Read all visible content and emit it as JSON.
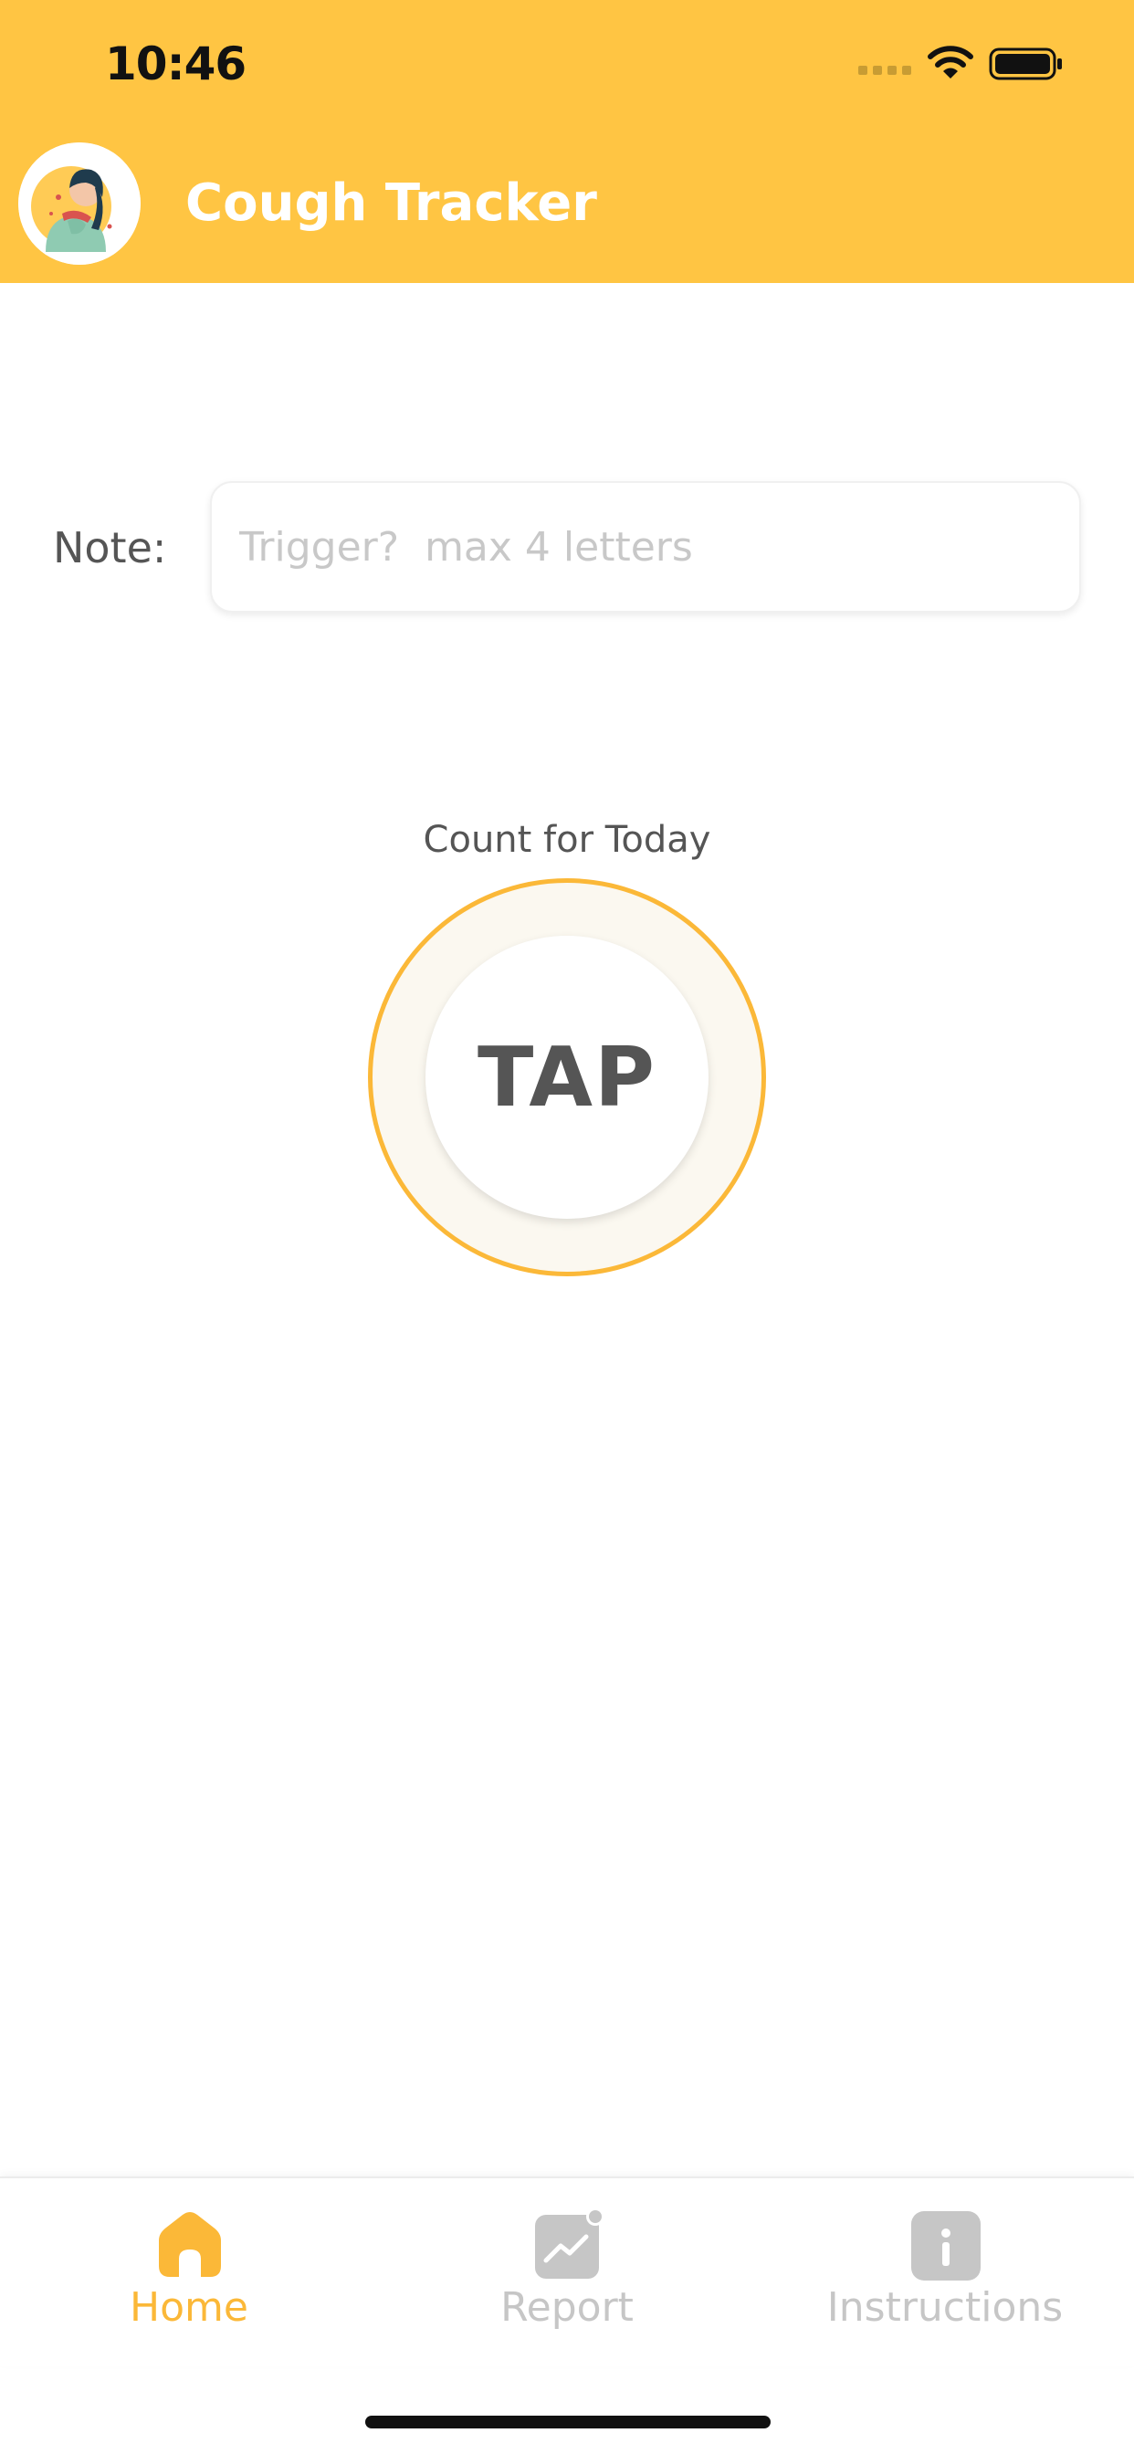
{
  "status_bar": {
    "time": "10:46"
  },
  "header": {
    "title": "Cough Tracker"
  },
  "note": {
    "label": "Note:",
    "placeholder": "Trigger?  max 4 letters",
    "value": ""
  },
  "counter": {
    "label": "Count for Today",
    "button_label": "TAP"
  },
  "tab_bar": {
    "active_tab": "Home",
    "items": [
      {
        "label": "Home",
        "icon": "home-icon"
      },
      {
        "label": "Report",
        "icon": "report-chart-icon"
      },
      {
        "label": "Instructions",
        "icon": "info-icon"
      }
    ]
  },
  "colors": {
    "brand_yellow": "#FFC543",
    "accent_orange": "#FBB838",
    "inactive_gray": "#c6c6c6",
    "text_dark": "#555555"
  }
}
